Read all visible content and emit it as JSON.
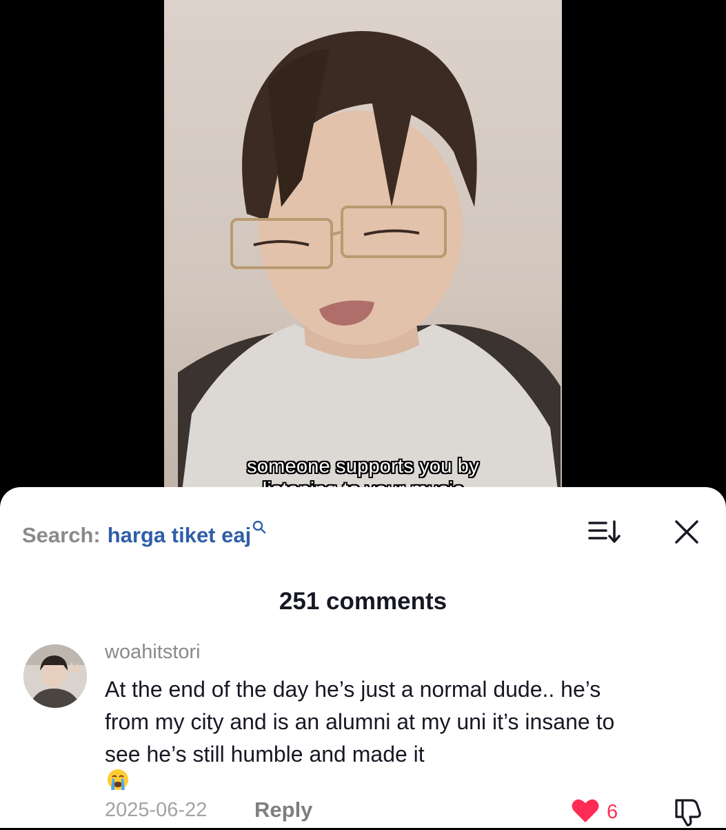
{
  "video": {
    "caption_line1": "someone supports you by",
    "caption_line2": "listening to your music"
  },
  "sheet": {
    "search_prefix": "Search:",
    "search_query": "harga tiket eaj",
    "comment_count": "251 comments"
  },
  "comment": {
    "username": "woahitstori",
    "text_line1": "At the end of the day he’s just a normal dude.. he’s",
    "text_line2": "from my city and is an alumni at my uni it’s insane to",
    "text_line3": "see he’s still humble and made it",
    "date": "2025-06-22",
    "reply_label": "Reply",
    "like_count": "6"
  },
  "colors": {
    "accent_link": "#2f5ea8",
    "like_red": "#fe2c55",
    "text_primary": "#161823",
    "text_secondary": "#8a8a8a"
  },
  "icons": [
    "search-icon",
    "sort-icon",
    "close-icon",
    "heart-icon",
    "dislike-icon",
    "crying-emoji-icon"
  ]
}
